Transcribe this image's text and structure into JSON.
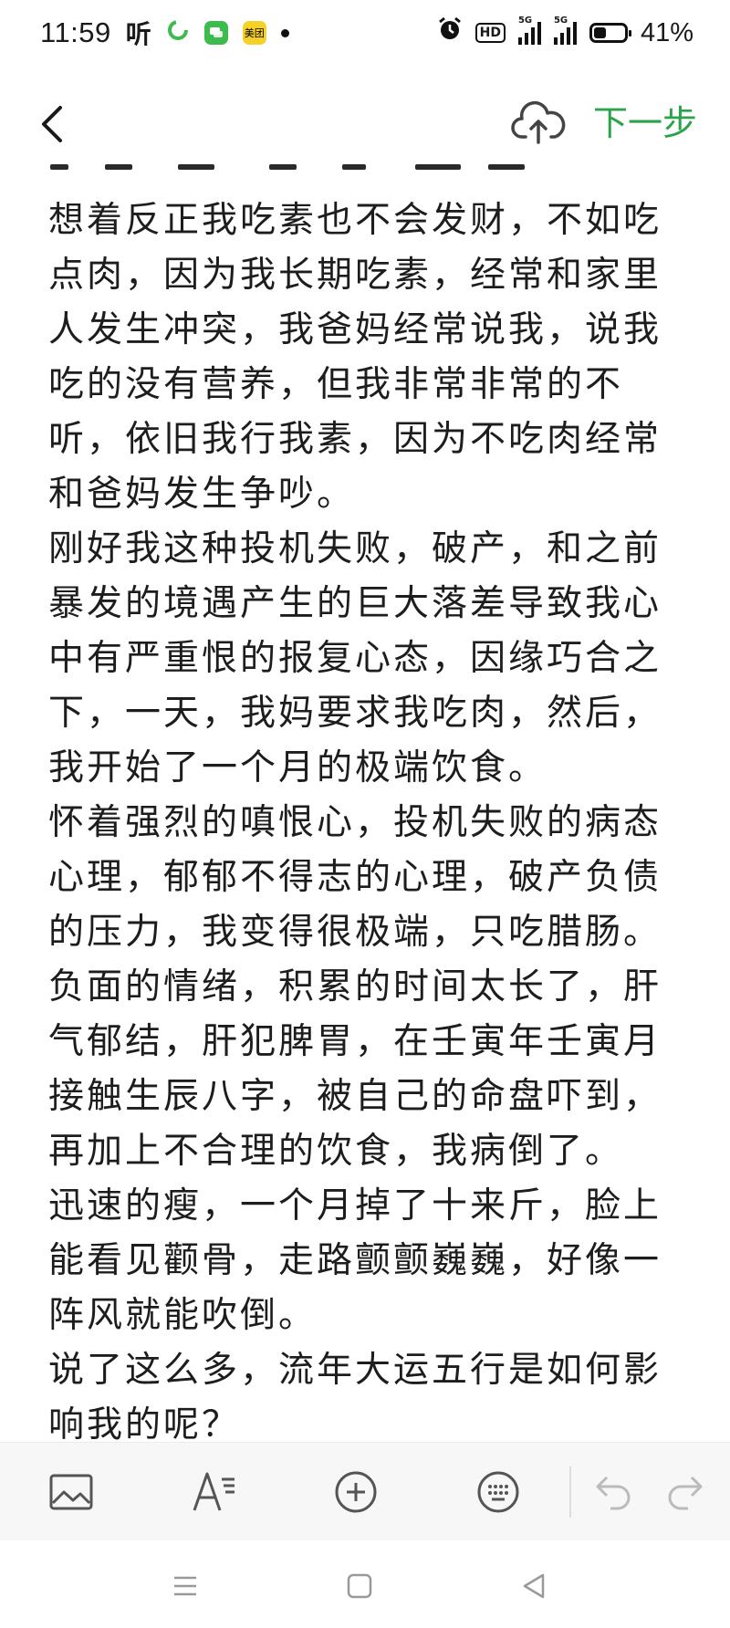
{
  "status_bar": {
    "time": "11:59",
    "ting_label": "听",
    "meituan_label": "美团",
    "hd_label": "HD",
    "signal_1_label": "5G",
    "signal_2_label": "5G",
    "battery_level": 0.41,
    "battery_percent": "41%"
  },
  "header": {
    "next_label": "下一步",
    "accent_color": "#2ba34a"
  },
  "content": {
    "paragraphs": [
      "想着反正我吃素也不会发财，不如吃点肉，因为我长期吃素，经常和家里人发生冲突，我爸妈经常说我，说我吃的没有营养，但我非常非常的不听，依旧我行我素，因为不吃肉经常和爸妈发生争吵。",
      "刚好我这种投机失败，破产，和之前暴发的境遇产生的巨大落差导致我心中有严重恨的报复心态，因缘巧合之下，一天，我妈要求我吃肉，然后，我开始了一个月的极端饮食。",
      "怀着强烈的嗔恨心，投机失败的病态心理，郁郁不得志的心理，破产负债的压力，我变得很极端，只吃腊肠。",
      "负面的情绪，积累的时间太长了，肝气郁结，肝犯脾胃，在壬寅年壬寅月接触生辰八字，被自己的命盘吓到，再加上不合理的饮食，我病倒了。",
      "迅速的瘦，一个月掉了十来斤，脸上能看见颧骨，走路颤颤巍巍，好像一阵风就能吹倒。",
      "说了这么多，流年大运五行是如何影响我的呢？"
    ]
  },
  "toolbar": {
    "icons": [
      "image-icon",
      "text-format-icon",
      "add-circle-icon",
      "keyboard-icon",
      "undo-icon",
      "redo-icon"
    ]
  },
  "navbar": {
    "icons": [
      "menu-icon",
      "home-square-icon",
      "back-triangle-icon"
    ]
  }
}
